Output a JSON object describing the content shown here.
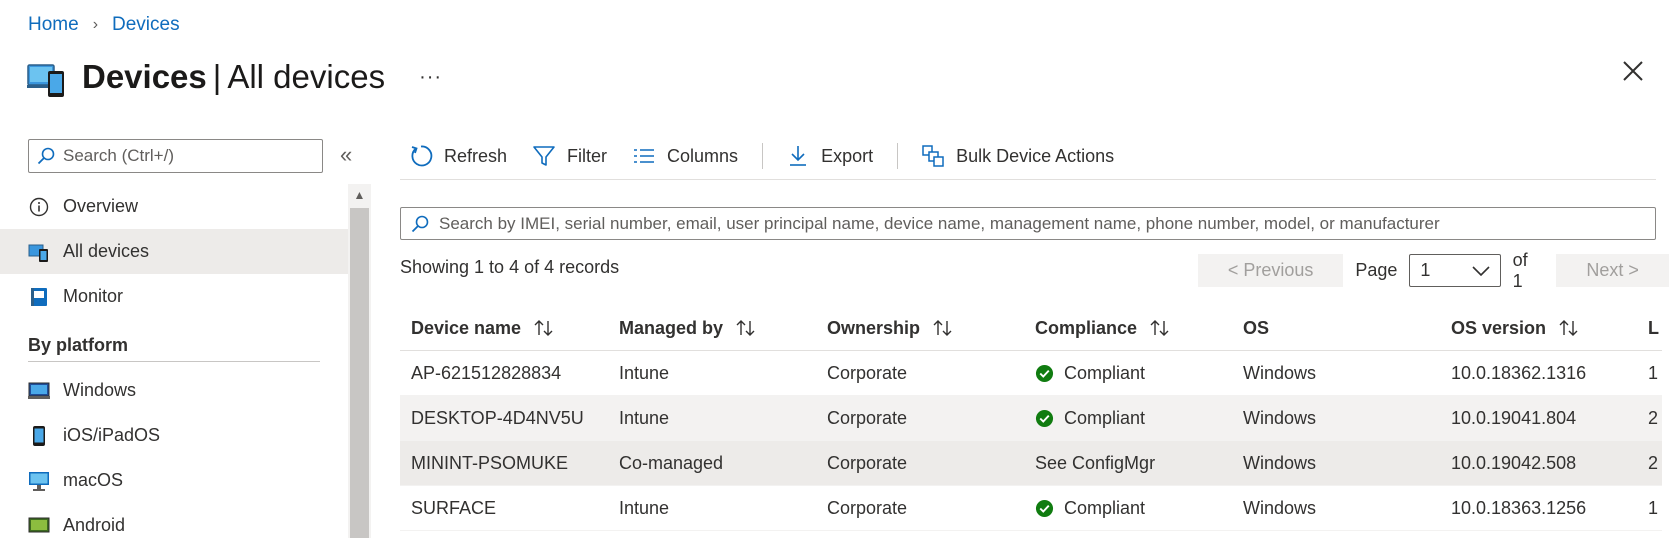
{
  "breadcrumb": {
    "home": "Home",
    "separator": "›",
    "devices": "Devices"
  },
  "header": {
    "title_main": "Devices",
    "title_divider": "|",
    "title_sub": "All devices",
    "more": "···"
  },
  "sidebar": {
    "search_placeholder": "Search (Ctrl+/)",
    "collapse": "«",
    "items": [
      {
        "label": "Overview",
        "icon": "info-icon"
      },
      {
        "label": "All devices",
        "icon": "devices-icon",
        "active": true
      },
      {
        "label": "Monitor",
        "icon": "monitor-book-icon"
      }
    ],
    "section": "By platform",
    "platforms": [
      {
        "label": "Windows",
        "icon": "windows-laptop-icon"
      },
      {
        "label": "iOS/iPadOS",
        "icon": "phone-icon"
      },
      {
        "label": "macOS",
        "icon": "desktop-icon"
      },
      {
        "label": "Android",
        "icon": "android-device-icon"
      }
    ]
  },
  "toolbar": {
    "refresh": "Refresh",
    "filter": "Filter",
    "columns": "Columns",
    "export": "Export",
    "bulk": "Bulk Device Actions"
  },
  "search": {
    "placeholder": "Search by IMEI, serial number, email, user principal name, device name, management name, phone number, model, or manufacturer"
  },
  "records": "Showing 1 to 4 of 4 records",
  "pager": {
    "previous": "< Previous",
    "page_label": "Page",
    "page_value": "1",
    "of": "of 1",
    "next": "Next >"
  },
  "table": {
    "columns": [
      "Device name",
      "Managed by",
      "Ownership",
      "Compliance",
      "OS",
      "OS version",
      "L"
    ],
    "rows": [
      {
        "device": "AP-621512828834",
        "managed": "Intune",
        "ownership": "Corporate",
        "compliance": "Compliant",
        "compliant_icon": true,
        "os": "Windows",
        "osver": "10.0.18362.1316",
        "last": "1"
      },
      {
        "device": "DESKTOP-4D4NV5U",
        "managed": "Intune",
        "ownership": "Corporate",
        "compliance": "Compliant",
        "compliant_icon": true,
        "os": "Windows",
        "osver": "10.0.19041.804",
        "last": "2"
      },
      {
        "device": "MININT-PSOMUKE",
        "managed": "Co-managed",
        "ownership": "Corporate",
        "compliance": "See ConfigMgr",
        "compliant_icon": false,
        "os": "Windows",
        "osver": "10.0.19042.508",
        "last": "2"
      },
      {
        "device": "SURFACE",
        "managed": "Intune",
        "ownership": "Corporate",
        "compliance": "Compliant",
        "compliant_icon": true,
        "os": "Windows",
        "osver": "10.0.18363.1256",
        "last": "1"
      }
    ]
  },
  "colors": {
    "accent": "#0f6cbd",
    "success": "#107c10",
    "active_bg": "#edebe9"
  }
}
